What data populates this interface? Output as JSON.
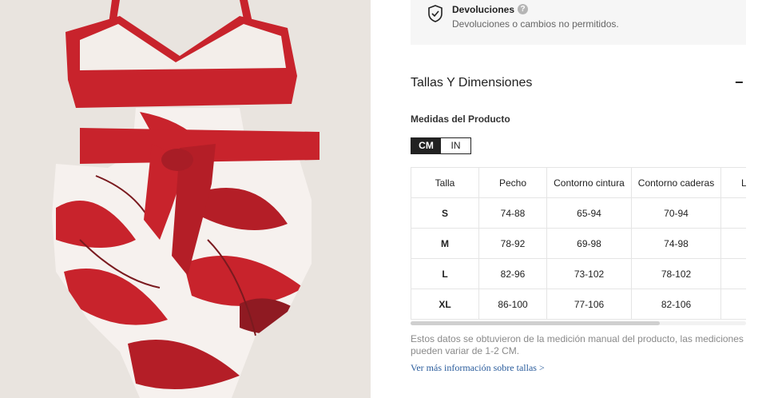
{
  "returns": {
    "title": "Devoluciones",
    "help_icon": "?",
    "description": "Devoluciones o cambios no permitidos.",
    "icon": "shield-check-icon"
  },
  "sizes_section": {
    "title": "Tallas Y Dimensiones",
    "collapse_symbol": "−",
    "measures_label": "Medidas del Producto",
    "units": [
      "CM",
      "IN"
    ],
    "selected_unit": "CM",
    "table": {
      "headers": [
        "Talla",
        "Pecho",
        "Contorno cintura",
        "Contorno caderas",
        "L"
      ],
      "rows": [
        {
          "size": "S",
          "chest": "74-88",
          "waist": "65-94",
          "hips": "70-94"
        },
        {
          "size": "M",
          "chest": "78-92",
          "waist": "69-98",
          "hips": "74-98"
        },
        {
          "size": "L",
          "chest": "82-96",
          "waist": "73-102",
          "hips": "78-102"
        },
        {
          "size": "XL",
          "chest": "86-100",
          "waist": "77-106",
          "hips": "82-106"
        }
      ]
    },
    "note": "Estos datos se obtuvieron de la medición manual del producto, las mediciones pueden variar de 1-2 CM.",
    "more_link": "Ver más información sobre tallas >"
  },
  "colors": {
    "swimsuit_red": "#c8232c",
    "background": "#e9e4df",
    "link": "#2a5c9c"
  }
}
